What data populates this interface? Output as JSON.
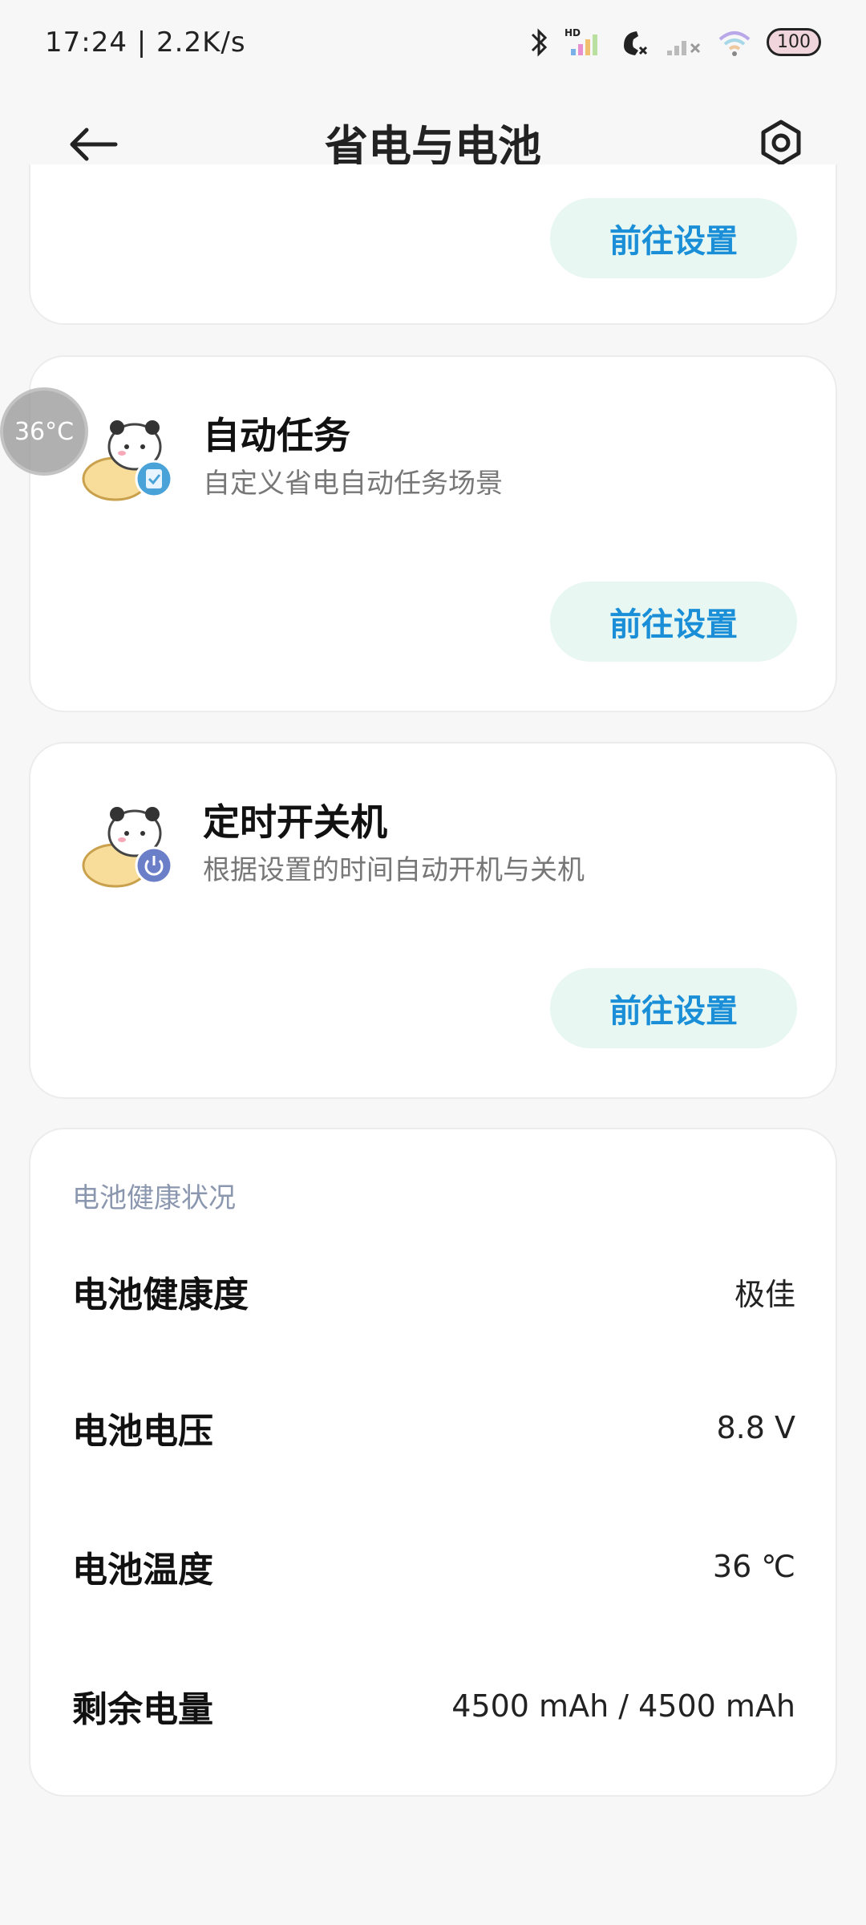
{
  "status_bar": {
    "time_speed": "17:24 | 2.2K/s",
    "hd_label": "HD",
    "battery_level": "100"
  },
  "header": {
    "title": "省电与电池"
  },
  "cards": {
    "top": {
      "button_label": "前往设置"
    },
    "auto_task": {
      "title": "自动任务",
      "description": "自定义省电自动任务场景",
      "button_label": "前往设置"
    },
    "scheduled_power": {
      "title": "定时开关机",
      "description": "根据设置的时间自动开机与关机",
      "button_label": "前往设置"
    }
  },
  "battery_health": {
    "section_title": "电池健康状况",
    "rows": [
      {
        "label": "电池健康度",
        "value": "极佳"
      },
      {
        "label": "电池电压",
        "value": "8.8 V"
      },
      {
        "label": "电池温度",
        "value": "36 ℃"
      },
      {
        "label": "剩余电量",
        "value": "4500 mAh / 4500 mAh"
      }
    ]
  },
  "floating_temp": "36°C",
  "colors": {
    "accent": "#1a8fd8",
    "button_bg": "#e8f7f2",
    "section_title": "#8b97ae"
  }
}
